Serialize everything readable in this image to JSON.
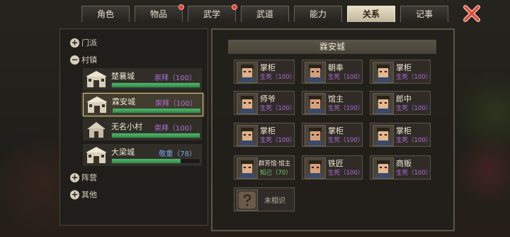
{
  "tabs": [
    {
      "label": "角色",
      "active": false,
      "dot": false
    },
    {
      "label": "物品",
      "active": false,
      "dot": true
    },
    {
      "label": "武学",
      "active": false,
      "dot": true
    },
    {
      "label": "武道",
      "active": false,
      "dot": false
    },
    {
      "label": "能力",
      "active": false,
      "dot": false
    },
    {
      "label": "关系",
      "active": true,
      "dot": false
    },
    {
      "label": "记事",
      "active": false,
      "dot": false
    }
  ],
  "categories": {
    "sect": "门派",
    "town": "村镇",
    "faction": "阵营",
    "other": "其他"
  },
  "towns": [
    {
      "name": "楚襄城",
      "relation": "崇拜（100）",
      "progress": 1.0,
      "selected": false
    },
    {
      "name": "霖安城",
      "relation": "崇拜（100）",
      "progress": 1.0,
      "selected": true
    },
    {
      "name": "无名小村",
      "relation": "崇拜（100）",
      "progress": 1.0,
      "selected": false
    },
    {
      "name": "大梁城",
      "relation": "敬重（78）",
      "progress": 0.78,
      "selected": false
    }
  ],
  "detail": {
    "title": "霖安城",
    "npcs": [
      {
        "name": "掌柜",
        "status": "生死（100）"
      },
      {
        "name": "朝奉",
        "status": "生死（100）"
      },
      {
        "name": "掌柜",
        "status": "生死（100）"
      },
      {
        "name": "师爷",
        "status": "生死（100）"
      },
      {
        "name": "馆主",
        "status": "生死（100）"
      },
      {
        "name": "郎中",
        "status": "生死（100）"
      },
      {
        "name": "掌柜",
        "status": "生死（100）"
      },
      {
        "name": "掌柜",
        "status": "生死（100）"
      },
      {
        "name": "掌柜",
        "status": "生死（100）"
      },
      {
        "name": "群芳馆·馆主",
        "status": "知己（70）"
      },
      {
        "name": "铁匠",
        "status": "生死（100）"
      },
      {
        "name": "商贩",
        "status": "生死（100）"
      },
      {
        "name": "未相识",
        "status": ""
      }
    ]
  },
  "colors": {
    "accent_gold": "#d9c28a",
    "relation_purple": "#b070e0",
    "relation_blue": "#7aa8e8",
    "relation_green": "#6ed46e",
    "bar_green": "#3ea058",
    "close_red": "#e04a3a"
  },
  "icons": {
    "close": "close-x-icon",
    "expand": "plus-circle-icon",
    "collapse": "minus-circle-icon",
    "town": "town-gate-icon",
    "portrait": "npc-portrait-icon",
    "unknown": "question-mark-icon"
  }
}
